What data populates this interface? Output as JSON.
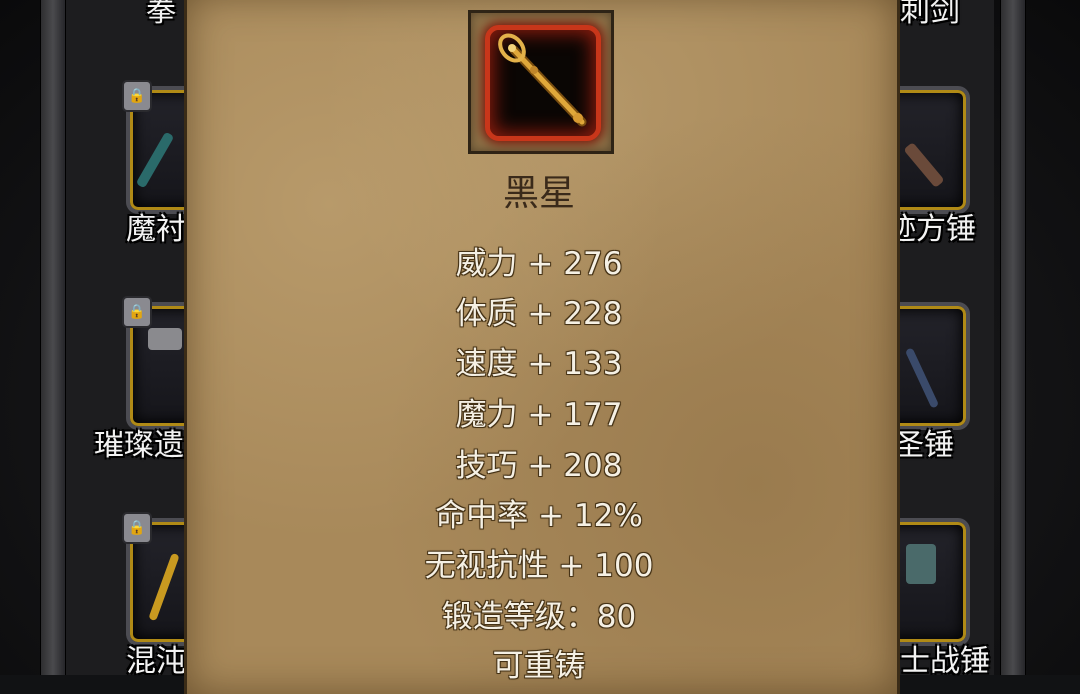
{
  "background_labels": {
    "left": [
      "拳",
      "魔衬",
      "璀璨遗",
      "混沌"
    ],
    "right": [
      "刺剑",
      "迹方锤",
      "圣锤",
      "士战锤"
    ]
  },
  "tooltip": {
    "item_name": "黑星",
    "item_icon": "golden-scepter-icon",
    "stats": [
      "威力 + 276",
      "体质 + 228",
      "速度 + 133",
      "魔力 + 177",
      "技巧 + 208",
      "命中率 + 12%",
      "无视抗性 + 100",
      "锻造等级：80",
      "可重铸"
    ]
  },
  "colors": {
    "parchment": "#a8895a",
    "icon_frame": "#c8361a",
    "slot_border": "#b08a16",
    "stat_text": "#f5f0e4",
    "name_text": "#3a2a1a"
  }
}
